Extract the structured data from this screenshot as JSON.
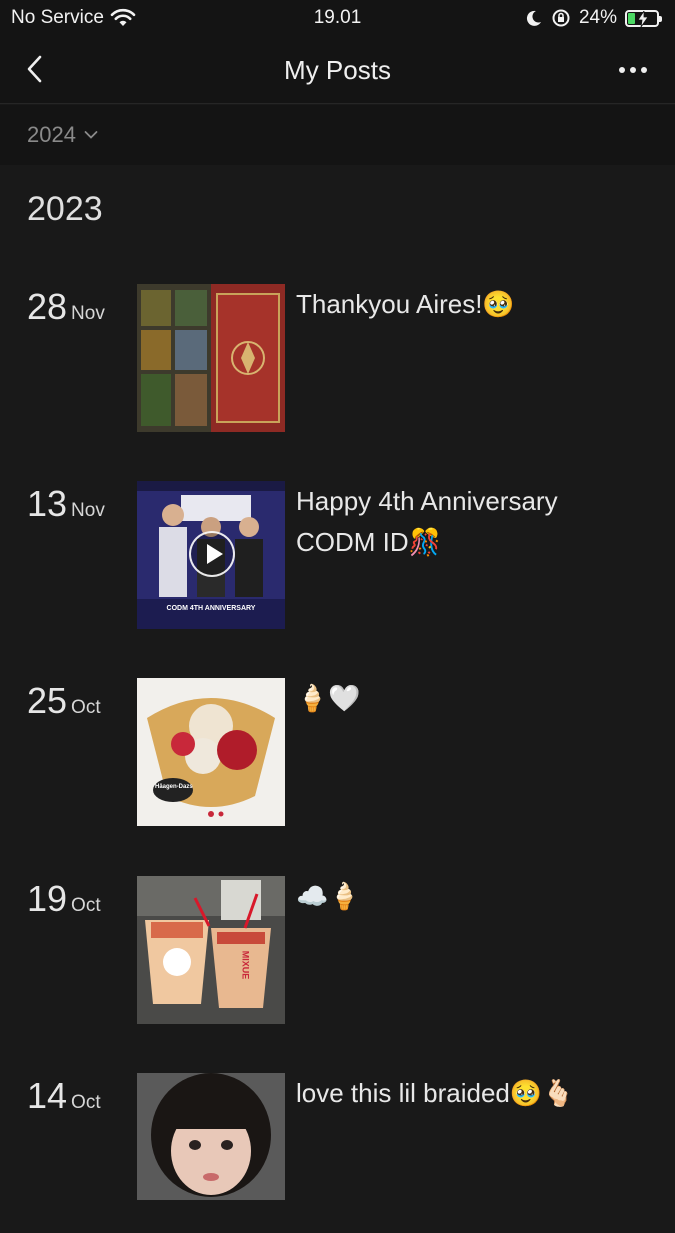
{
  "status_bar": {
    "carrier": "No Service",
    "time": "19.01",
    "battery_percent": "24%",
    "battery_level": 0.24
  },
  "nav": {
    "title": "My Posts"
  },
  "filter": {
    "selected_year": "2024"
  },
  "section": {
    "year": "2023"
  },
  "posts": [
    {
      "day": "28",
      "month": "Nov",
      "caption": "Thankyou Aires!🥹"
    },
    {
      "day": "13",
      "month": "Nov",
      "caption": "Happy 4th Anniversary CODM ID🎊",
      "thumb_text": "CODM 4TH ANNIVERSARY"
    },
    {
      "day": "25",
      "month": "Oct",
      "caption": "🍦🤍",
      "thumb_text": "Häagen-Dazs"
    },
    {
      "day": "19",
      "month": "Oct",
      "caption": "☁️🍦",
      "thumb_text": "MIXUE"
    },
    {
      "day": "14",
      "month": "Oct",
      "caption": "love this lil braided🥹🫰🏻"
    }
  ],
  "colors": {
    "background": "#191919",
    "bar": "#141414",
    "battery_fill": "#4cd964"
  }
}
